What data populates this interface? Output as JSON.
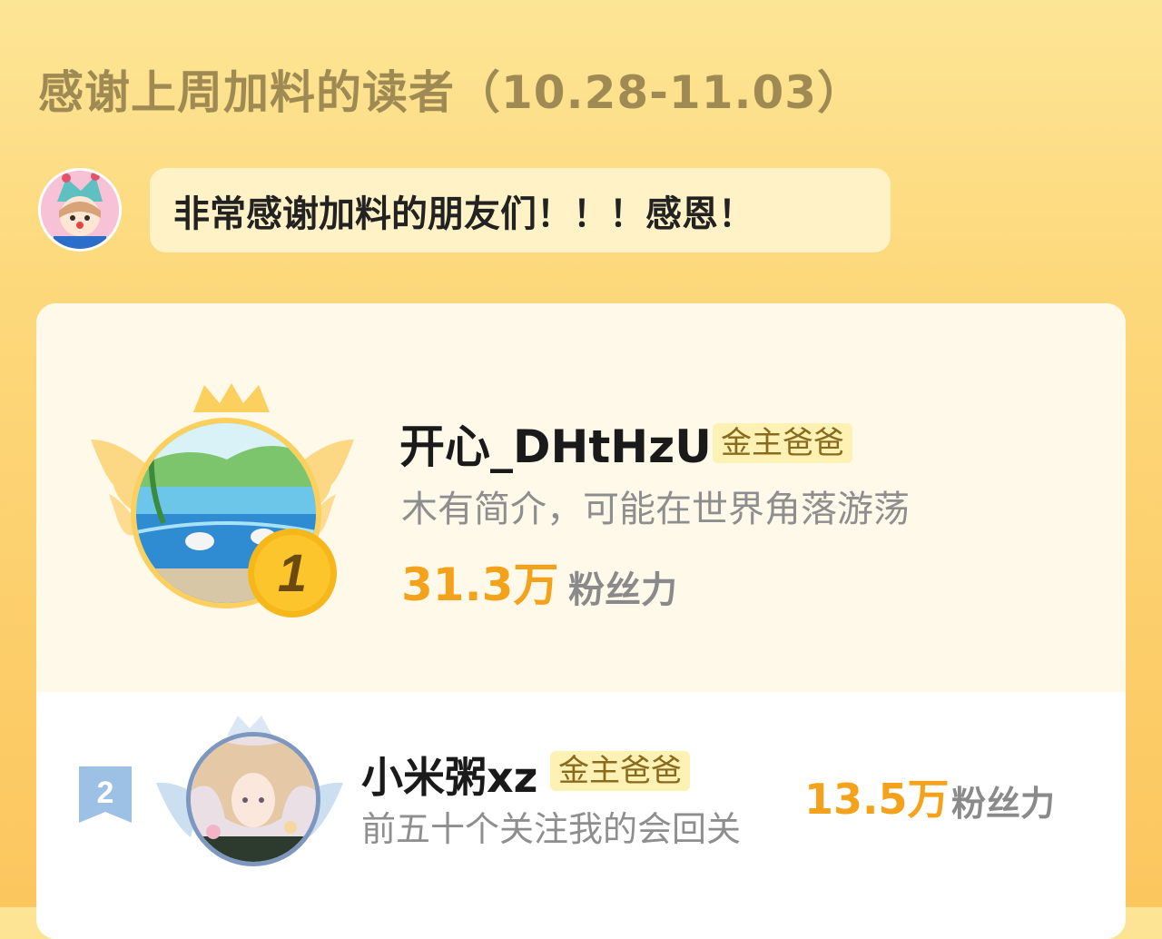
{
  "header": {
    "title": "感谢上周加料的读者（10.28-11.03）"
  },
  "message": {
    "text": "非常感谢加料的朋友们！！！感恩！"
  },
  "readers": [
    {
      "rank": "1",
      "name": "开心_DHtHzU",
      "badge": "金主爸爸",
      "bio": "木有简介，可能在世界角落游荡",
      "fans": "31.3万",
      "fans_label": "粉丝力"
    },
    {
      "rank": "2",
      "name": "小米粥xz",
      "badge": "金主爸爸",
      "bio": "前五十个关注我的会回关",
      "fans": "13.5万",
      "fans_label": "粉丝力"
    }
  ],
  "colors": {
    "accent": "#f4a21b",
    "title": "#a08a54",
    "badge_bg": "#fdf1b4"
  }
}
